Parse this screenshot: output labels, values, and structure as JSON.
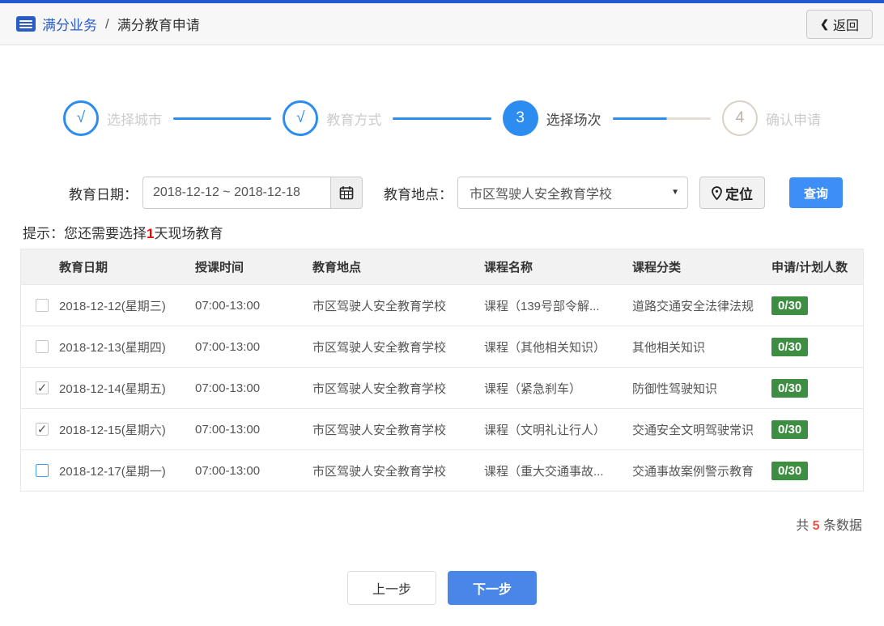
{
  "header": {
    "breadcrumb_section": "满分业务",
    "breadcrumb_separator": "/",
    "breadcrumb_page": "满分教育申请",
    "back_chevron": "❮",
    "back_label": "返回"
  },
  "steps": {
    "items": [
      {
        "marker": "√",
        "label": "选择城市",
        "state": "done"
      },
      {
        "marker": "√",
        "label": "教育方式",
        "state": "done"
      },
      {
        "marker": "3",
        "label": "选择场次",
        "state": "active"
      },
      {
        "marker": "4",
        "label": "确认申请",
        "state": "pending"
      }
    ]
  },
  "filters": {
    "date_label": "教育日期：",
    "date_value": "2018-12-12 ~ 2018-12-18",
    "location_label": "教育地点：",
    "location_value": "市区驾驶人安全教育学校",
    "select_caret": "▼",
    "locate_label": "定位",
    "search_label": "查询"
  },
  "hint": {
    "prefix": "提示：您还需要选择",
    "count": "1",
    "suffix": "天现场教育"
  },
  "table": {
    "check_glyph": "✓",
    "headers": [
      "教育日期",
      "授课时间",
      "教育地点",
      "课程名称",
      "课程分类",
      "申请/计划人数"
    ],
    "rows": [
      {
        "checked": false,
        "highlight": false,
        "date": "2018-12-12(星期三)",
        "time": "07:00-13:00",
        "place": "市区驾驶人安全教育学校",
        "course": "课程（139号部令解...",
        "category": "道路交通安全法律法规",
        "quota": "0/30"
      },
      {
        "checked": false,
        "highlight": false,
        "date": "2018-12-13(星期四)",
        "time": "07:00-13:00",
        "place": "市区驾驶人安全教育学校",
        "course": "课程（其他相关知识）",
        "category": "其他相关知识",
        "quota": "0/30"
      },
      {
        "checked": true,
        "highlight": false,
        "date": "2018-12-14(星期五)",
        "time": "07:00-13:00",
        "place": "市区驾驶人安全教育学校",
        "course": "课程（紧急刹车）",
        "category": "防御性驾驶知识",
        "quota": "0/30"
      },
      {
        "checked": true,
        "highlight": false,
        "date": "2018-12-15(星期六)",
        "time": "07:00-13:00",
        "place": "市区驾驶人安全教育学校",
        "course": "课程（文明礼让行人）",
        "category": "交通安全文明驾驶常识",
        "quota": "0/30"
      },
      {
        "checked": false,
        "highlight": true,
        "date": "2018-12-17(星期一)",
        "time": "07:00-13:00",
        "place": "市区驾驶人安全教育学校",
        "course": "课程（重大交通事故...",
        "category": "交通事故案例警示教育",
        "quota": "0/30"
      }
    ]
  },
  "footer": {
    "total_prefix": "共 ",
    "total_count": "5",
    "total_suffix": " 条数据"
  },
  "actions": {
    "prev_label": "上一步",
    "next_label": "下一步"
  },
  "colors": {
    "topbar_blue": "#2257cd",
    "brand_blue": "#2a5cc8",
    "step_blue": "#2d8cf0",
    "button_blue": "#3e8ef7",
    "badge_green": "#3e8e41",
    "alert_red": "#ff0000",
    "count_red": "#f0503c"
  }
}
